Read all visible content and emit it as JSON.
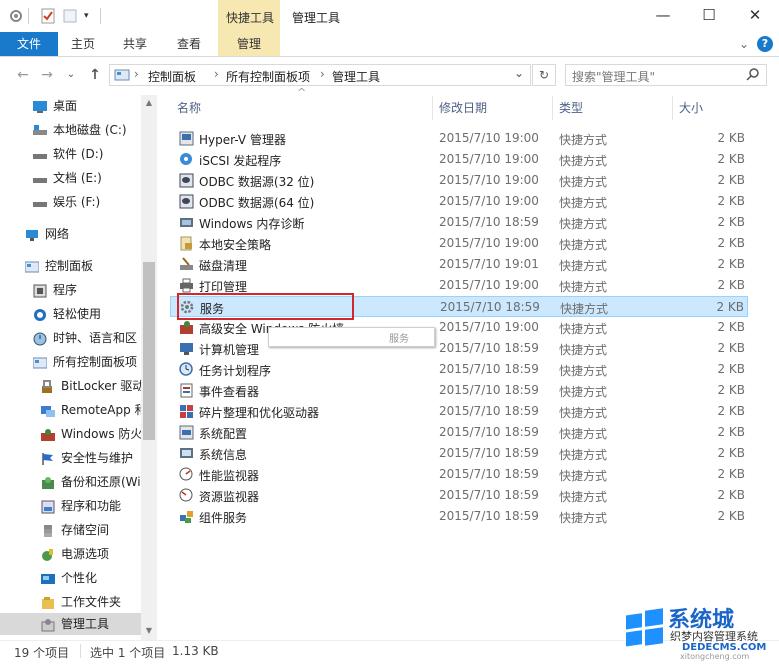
{
  "titlebar": {
    "context_tab_group": "快捷工具",
    "window_title": "管理工具",
    "minimize": "—",
    "maximize": "☐",
    "close": "✕"
  },
  "ribbon": {
    "tabs": [
      "文件",
      "主页",
      "共享",
      "查看",
      "管理"
    ],
    "expand": "⌄",
    "help": "?"
  },
  "address": {
    "back": "←",
    "forward": "→",
    "recent": "⌄",
    "up": "↑",
    "crumbs": [
      "控制面板",
      "所有控制面板项",
      "管理工具"
    ],
    "separator": "›",
    "dropdown": "⌄",
    "refresh": "↻",
    "search_placeholder": "搜索\"管理工具\""
  },
  "nav": {
    "items": [
      "桌面",
      "本地磁盘 (C:)",
      "软件 (D:)",
      "文档 (E:)",
      "娱乐 (F:)",
      "网络",
      "控制面板",
      "程序",
      "轻松使用",
      "时钟、语言和区",
      "所有控制面板项",
      "BitLocker 驱动",
      "RemoteApp 和",
      "Windows 防火",
      "安全性与维护",
      "备份和还原(Wi",
      "程序和功能",
      "存储空间",
      "电源选项",
      "个性化",
      "工作文件夹",
      "管理工具"
    ],
    "scroll_up": "▲",
    "scroll_down": "▼"
  },
  "columns": {
    "name": "名称",
    "modified": "修改日期",
    "type": "类型",
    "size": "大小",
    "sort_arrow": "^"
  },
  "files": [
    {
      "name": "Hyper-V 管理器",
      "date": "2015/7/10 19:00",
      "type": "快捷方式",
      "size": "2 KB"
    },
    {
      "name": "iSCSI 发起程序",
      "date": "2015/7/10 19:00",
      "type": "快捷方式",
      "size": "2 KB"
    },
    {
      "name": "ODBC 数据源(32 位)",
      "date": "2015/7/10 19:00",
      "type": "快捷方式",
      "size": "2 KB"
    },
    {
      "name": "ODBC 数据源(64 位)",
      "date": "2015/7/10 19:00",
      "type": "快捷方式",
      "size": "2 KB"
    },
    {
      "name": "Windows 内存诊断",
      "date": "2015/7/10 18:59",
      "type": "快捷方式",
      "size": "2 KB"
    },
    {
      "name": "本地安全策略",
      "date": "2015/7/10 19:00",
      "type": "快捷方式",
      "size": "2 KB"
    },
    {
      "name": "磁盘清理",
      "date": "2015/7/10 19:01",
      "type": "快捷方式",
      "size": "2 KB"
    },
    {
      "name": "打印管理",
      "date": "2015/7/10 19:00",
      "type": "快捷方式",
      "size": "2 KB"
    },
    {
      "name": "服务",
      "date": "2015/7/10 18:59",
      "type": "快捷方式",
      "size": "2 KB"
    },
    {
      "name": "高级安全 Windows 防火墙",
      "date": "2015/7/10 19:00",
      "type": "快捷方式",
      "size": "2 KB"
    },
    {
      "name": "计算机管理",
      "date": "2015/7/10 18:59",
      "type": "快捷方式",
      "size": "2 KB"
    },
    {
      "name": "任务计划程序",
      "date": "2015/7/10 18:59",
      "type": "快捷方式",
      "size": "2 KB"
    },
    {
      "name": "事件查看器",
      "date": "2015/7/10 18:59",
      "type": "快捷方式",
      "size": "2 KB"
    },
    {
      "name": "碎片整理和优化驱动器",
      "date": "2015/7/10 18:59",
      "type": "快捷方式",
      "size": "2 KB"
    },
    {
      "name": "系统配置",
      "date": "2015/7/10 18:59",
      "type": "快捷方式",
      "size": "2 KB"
    },
    {
      "name": "系统信息",
      "date": "2015/7/10 18:59",
      "type": "快捷方式",
      "size": "2 KB"
    },
    {
      "name": "性能监视器",
      "date": "2015/7/10 18:59",
      "type": "快捷方式",
      "size": "2 KB"
    },
    {
      "name": "资源监视器",
      "date": "2015/7/10 18:59",
      "type": "快捷方式",
      "size": "2 KB"
    },
    {
      "name": "组件服务",
      "date": "2015/7/10 18:59",
      "type": "快捷方式",
      "size": "2 KB"
    }
  ],
  "selected_index": 8,
  "tooltip_text": "服务",
  "status": {
    "count": "19 个项目",
    "selection": "选中 1 个项目",
    "selection_size": "1.13 KB"
  },
  "watermark": {
    "brand": "系统城",
    "line2": "织梦内容管理系统",
    "url": "DEDECMS.COM",
    "url2": "xitongcheng.com"
  },
  "colors": {
    "accent": "#1979ca",
    "context_tab": "#f7e7b0",
    "selection_fill": "#cce8ff",
    "selection_border": "#99d1ff",
    "highlight_box": "#d0282d",
    "header_text": "#4d6185"
  }
}
